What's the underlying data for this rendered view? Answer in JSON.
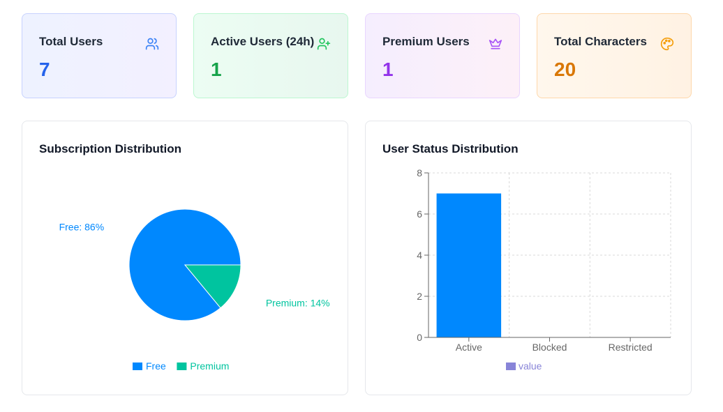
{
  "stats": [
    {
      "title": "Total Users",
      "value": "7",
      "icon": "users-icon",
      "color": "#2563eb",
      "icon_color": "#3b82f6"
    },
    {
      "title": "Active Users (24h)",
      "value": "1",
      "icon": "user-plus-icon",
      "color": "#16a34a",
      "icon_color": "#22c55e"
    },
    {
      "title": "Premium Users",
      "value": "1",
      "icon": "crown-icon",
      "color": "#9333ea",
      "icon_color": "#a855f7"
    },
    {
      "title": "Total Characters",
      "value": "20",
      "icon": "palette-icon",
      "color": "#d97706",
      "icon_color": "#f59e0b"
    }
  ],
  "chart_data": [
    {
      "type": "pie",
      "title": "Subscription Distribution",
      "categories": [
        "Free",
        "Premium"
      ],
      "values": [
        86,
        14
      ],
      "labels": [
        "Free: 86%",
        "Premium: 14%"
      ],
      "colors": [
        "#0088fe",
        "#00c49f"
      ],
      "legend": [
        "Free",
        "Premium"
      ],
      "legend_position": "bottom"
    },
    {
      "type": "bar",
      "title": "User Status Distribution",
      "categories": [
        "Active",
        "Blocked",
        "Restricted"
      ],
      "series": [
        {
          "name": "value",
          "values": [
            7,
            0,
            0
          ]
        }
      ],
      "ylim": [
        0,
        8
      ],
      "yticks": [
        "0",
        "2",
        "4",
        "6",
        "8"
      ],
      "bar_color": "#0088fe",
      "legend_color": "#8884d8",
      "grid": true,
      "legend_position": "bottom"
    }
  ]
}
